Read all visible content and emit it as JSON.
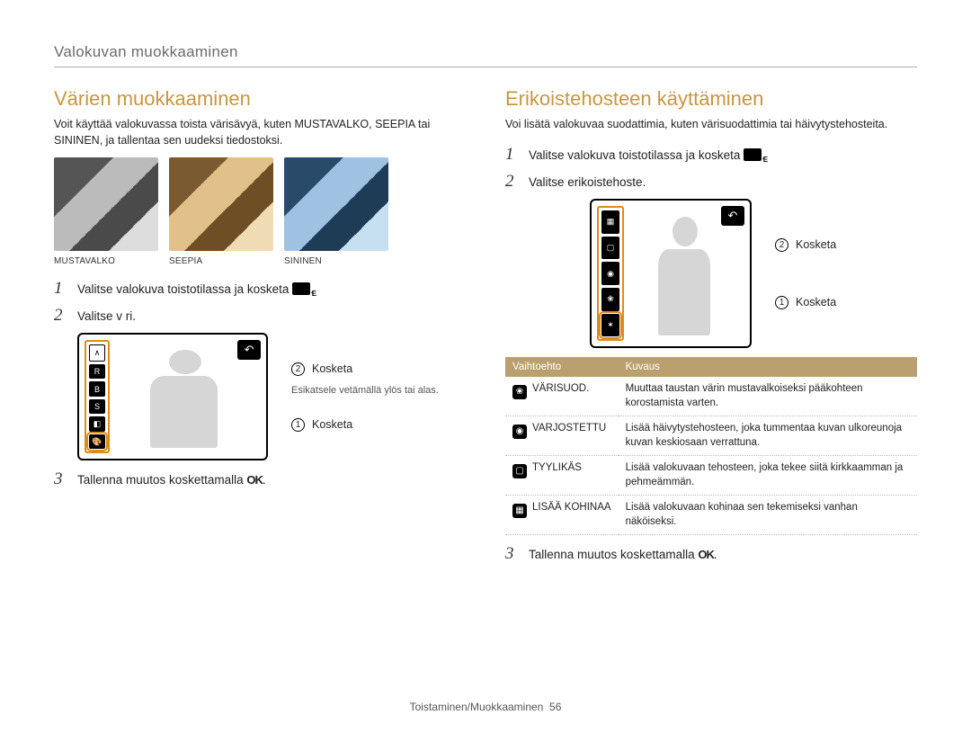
{
  "breadcrumb": "Valokuvan muokkaaminen",
  "left": {
    "heading": "Värien muokkaaminen",
    "intro": "Voit käyttää valokuvassa toista värisävyä, kuten MUSTAVALKO, SEEPIA tai SININEN, ja tallentaa sen uudeksi tiedostoksi.",
    "thumbs": [
      {
        "label": "MUSTAVALKO"
      },
      {
        "label": "SEEPIA"
      },
      {
        "label": "SININEN"
      }
    ],
    "step1": "Valitse valokuva toistotilassa ja kosketa",
    "step2": "Valitse v ri.",
    "ui": {
      "kosketa2": "Kosketa",
      "hint": "Esikatsele vetämällä ylös tai alas.",
      "kosketa1": "Kosketa"
    },
    "step3_before": "Tallenna muutos koskettamalla",
    "step3_ok": "OK"
  },
  "right": {
    "heading": "Erikoistehosteen käyttäminen",
    "intro": "Voi lisätä valokuvaa suodattimia, kuten värisuodattimia tai häivytystehosteita.",
    "step1": "Valitse valokuva toistotilassa ja kosketa",
    "step2": "Valitse erikoistehoste.",
    "ui": {
      "kosketa2": "Kosketa",
      "kosketa1": "Kosketa"
    },
    "table": {
      "head_option": "Vaihtoehto",
      "head_desc": "Kuvaus",
      "rows": [
        {
          "name": "VÄRISUOD.",
          "desc": "Muuttaa taustan värin mustavalkoiseksi pääkohteen korostamista varten."
        },
        {
          "name": "VARJOSTETTU",
          "desc": "Lisää häivytystehosteen, joka tummentaa kuvan ulkoreunoja kuvan keskiosaan verrattuna."
        },
        {
          "name": "TYYLIKÄS",
          "desc": "Lisää valokuvaan tehosteen, joka tekee siitä kirkkaamman ja pehmeämmän."
        },
        {
          "name": "LISÄÄ KOHINAA",
          "desc": "Lisää valokuvaan kohinaa sen tekemiseksi vanhan näköiseksi."
        }
      ]
    },
    "step3_before": "Tallenna muutos koskettamalla",
    "step3_ok": "OK"
  },
  "footer": {
    "section": "Toistaminen/Muokkaaminen",
    "page": "56"
  }
}
